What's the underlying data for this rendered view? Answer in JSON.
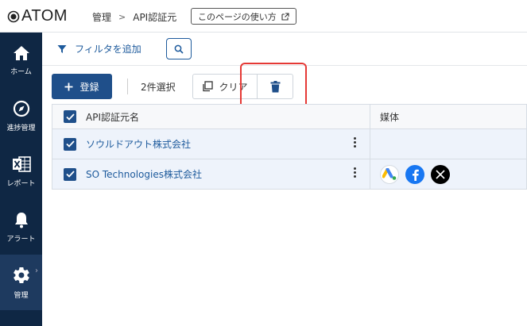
{
  "app": {
    "logo_text": "ATOM"
  },
  "breadcrumb": {
    "root": "管理",
    "current": "API認証元",
    "howto_label": "このページの使い方"
  },
  "sidebar": {
    "items": [
      {
        "label": "ホーム",
        "icon": "home-icon"
      },
      {
        "label": "進捗管理",
        "icon": "compass-icon"
      },
      {
        "label": "レポート",
        "icon": "excel-icon"
      },
      {
        "label": "アラート",
        "icon": "bell-icon"
      },
      {
        "label": "管理",
        "icon": "gear-icon",
        "active": true
      }
    ]
  },
  "filterbar": {
    "add_filter_label": "フィルタを追加"
  },
  "toolbar": {
    "register_label": "登録",
    "selected_count": "2件選択",
    "clear_label": "クリア"
  },
  "table": {
    "columns": [
      "API認証元名",
      "媒体"
    ],
    "rows": [
      {
        "name": "ソウルドアウト株式会社",
        "checked": true,
        "media": []
      },
      {
        "name": "SO Technologies株式会社",
        "checked": true,
        "media": [
          "google-ads-icon",
          "facebook-icon",
          "x-icon"
        ]
      }
    ]
  },
  "colors": {
    "primary": "#1f4f8a",
    "sidebar_bg": "#0f2744",
    "link": "#1d5a9c",
    "highlight": "#e53935"
  }
}
